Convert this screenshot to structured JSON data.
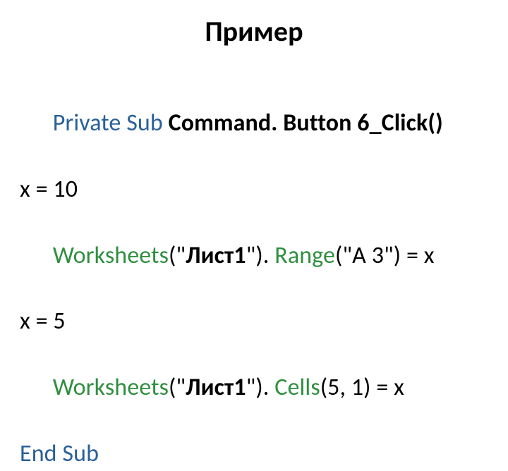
{
  "title": "Пример",
  "l1": {
    "privatesub": "Private Sub",
    "sp": " ",
    "fn": "Command. Button 6_Click()"
  },
  "l2": "x = 10",
  "l3": {
    "ws": "Worksheets",
    "op": "(\"",
    "sheet": "Лист1",
    "cl": "\"). ",
    "rng": "Range",
    "rest": "(\"A 3\") = x"
  },
  "l4": "x = 5",
  "l5": {
    "ws": "Worksheets",
    "op": "(\"",
    "sheet": "Лист1",
    "cl": "\"). ",
    "cells": "Cells",
    "rest": "(5, 1) = x"
  },
  "l6": "End Sub"
}
